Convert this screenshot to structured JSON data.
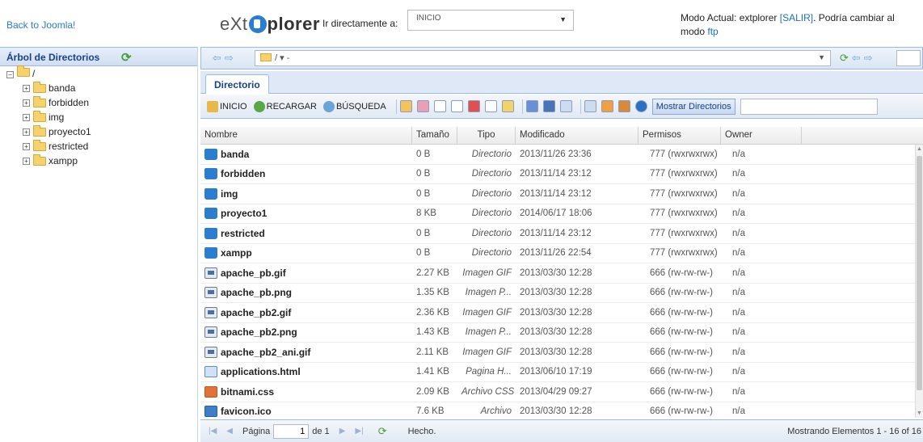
{
  "header": {
    "back_link": "Back to Joomla!",
    "logo_prefix": "eXt",
    "logo_suffix": "plorer",
    "goto_label": "Ir directamente a:",
    "goto_value": "INICIO",
    "mode_prefix": "Modo Actual: extplorer ",
    "logout": "[SALIR]",
    "mode_middle": ". Podría cambiar al modo ",
    "mode_ftp": "ftp"
  },
  "tree": {
    "title": "Árbol de Directorios",
    "root": "/",
    "items": [
      "banda",
      "forbidden",
      "img",
      "proyecto1",
      "restricted",
      "xampp"
    ]
  },
  "nav": {
    "path": "/ ▾ -"
  },
  "tab": {
    "label": "Directorio"
  },
  "toolbar": {
    "home": "INICIO",
    "reload": "RECARGAR",
    "search": "BÚSQUEDA",
    "show_dirs": "Mostrar Directorios"
  },
  "grid": {
    "columns": {
      "name": "Nombre",
      "size": "Tamaño",
      "type": "Tipo",
      "modified": "Modificado",
      "perms": "Permisos",
      "owner": "Owner"
    },
    "rows": [
      {
        "icon": "dir",
        "name": "banda",
        "size": "0 B",
        "type": "Directorio",
        "modified": "2013/11/26 23:36",
        "perms": "777 (rwxrwxrwx)",
        "owner": "n/a"
      },
      {
        "icon": "dir",
        "name": "forbidden",
        "size": "0 B",
        "type": "Directorio",
        "modified": "2013/11/14 23:12",
        "perms": "777 (rwxrwxrwx)",
        "owner": "n/a"
      },
      {
        "icon": "dir",
        "name": "img",
        "size": "0 B",
        "type": "Directorio",
        "modified": "2013/11/14 23:12",
        "perms": "777 (rwxrwxrwx)",
        "owner": "n/a"
      },
      {
        "icon": "dir",
        "name": "proyecto1",
        "size": "8 KB",
        "type": "Directorio",
        "modified": "2014/06/17 18:06",
        "perms": "777 (rwxrwxrwx)",
        "owner": "n/a"
      },
      {
        "icon": "dir",
        "name": "restricted",
        "size": "0 B",
        "type": "Directorio",
        "modified": "2013/11/14 23:12",
        "perms": "777 (rwxrwxrwx)",
        "owner": "n/a"
      },
      {
        "icon": "dir",
        "name": "xampp",
        "size": "0 B",
        "type": "Directorio",
        "modified": "2013/11/26 22:54",
        "perms": "777 (rwxrwxrwx)",
        "owner": "n/a"
      },
      {
        "icon": "img",
        "name": "apache_pb.gif",
        "size": "2.27 KB",
        "type": "Imagen GIF",
        "modified": "2013/03/30 12:28",
        "perms": "666 (rw-rw-rw-)",
        "owner": "n/a"
      },
      {
        "icon": "img",
        "name": "apache_pb.png",
        "size": "1.35 KB",
        "type": "Imagen P...",
        "modified": "2013/03/30 12:28",
        "perms": "666 (rw-rw-rw-)",
        "owner": "n/a"
      },
      {
        "icon": "img",
        "name": "apache_pb2.gif",
        "size": "2.36 KB",
        "type": "Imagen GIF",
        "modified": "2013/03/30 12:28",
        "perms": "666 (rw-rw-rw-)",
        "owner": "n/a"
      },
      {
        "icon": "img",
        "name": "apache_pb2.png",
        "size": "1.43 KB",
        "type": "Imagen P...",
        "modified": "2013/03/30 12:28",
        "perms": "666 (rw-rw-rw-)",
        "owner": "n/a"
      },
      {
        "icon": "img",
        "name": "apache_pb2_ani.gif",
        "size": "2.11 KB",
        "type": "Imagen GIF",
        "modified": "2013/03/30 12:28",
        "perms": "666 (rw-rw-rw-)",
        "owner": "n/a"
      },
      {
        "icon": "html",
        "name": "applications.html",
        "size": "1.41 KB",
        "type": "Pagina H...",
        "modified": "2013/06/10 17:19",
        "perms": "666 (rw-rw-rw-)",
        "owner": "n/a"
      },
      {
        "icon": "css",
        "name": "bitnami.css",
        "size": "2.09 KB",
        "type": "Archivo CSS",
        "modified": "2013/04/29 09:27",
        "perms": "666 (rw-rw-rw-)",
        "owner": "n/a"
      },
      {
        "icon": "ico",
        "name": "favicon.ico",
        "size": "7.6 KB",
        "type": "Archivo",
        "modified": "2013/03/30 12:28",
        "perms": "666 (rw-rw-rw-)",
        "owner": "n/a"
      }
    ]
  },
  "pager": {
    "page_label": "Página",
    "page_value": "1",
    "of_label": "de 1",
    "status": "Hecho.",
    "count": "Mostrando Elementos 1 - 16 of 16"
  },
  "colors": {
    "accent": "#15428b",
    "link": "#2a7dc9",
    "border": "#99bbe8"
  }
}
